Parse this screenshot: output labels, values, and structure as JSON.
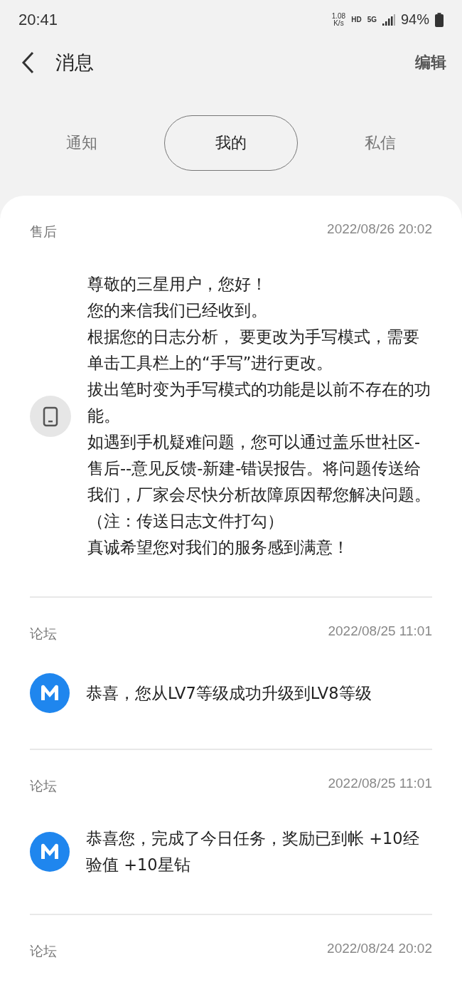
{
  "status_bar": {
    "time": "20:41",
    "speed_value": "1.08",
    "speed_unit": "K/s",
    "hd": "HD",
    "network": "5G",
    "battery": "94%"
  },
  "header": {
    "title": "消息",
    "action": "编辑"
  },
  "tabs": [
    {
      "label": "通知",
      "selected": false
    },
    {
      "label": "我的",
      "selected": true
    },
    {
      "label": "私信",
      "selected": false
    }
  ],
  "messages": [
    {
      "category": "售后",
      "time": "2022/08/26 20:02",
      "kind": "phone",
      "paragraphs": [
        "尊敬的三星用户，您好！",
        "您的来信我们已经收到。",
        "根据您的日志分析， 要更改为手写模式，需要单击工具栏上的“手写”进行更改。",
        "拔出笔时变为手写模式的功能是以前不存在的功能。",
        "如遇到手机疑难问题，您可以通过盖乐世社区-售后--意见反馈-新建-错误报告。将问题传送给我们，厂家会尽快分析故障原因帮您解决问题。（注：传送日志文件打勾）",
        "真诚希望您对我们的服务感到满意！"
      ]
    },
    {
      "category": "论坛",
      "time": "2022/08/25 11:01",
      "kind": "forum",
      "paragraphs": [
        "恭喜，您从LV7等级成功升级到LV8等级"
      ]
    },
    {
      "category": "论坛",
      "time": "2022/08/25 11:01",
      "kind": "forum",
      "paragraphs": [
        "恭喜您，完成了今日任务，奖励已到帐 +10经验值 +10星钻"
      ]
    },
    {
      "category": "论坛",
      "time": "2022/08/24 20:02"
    }
  ]
}
